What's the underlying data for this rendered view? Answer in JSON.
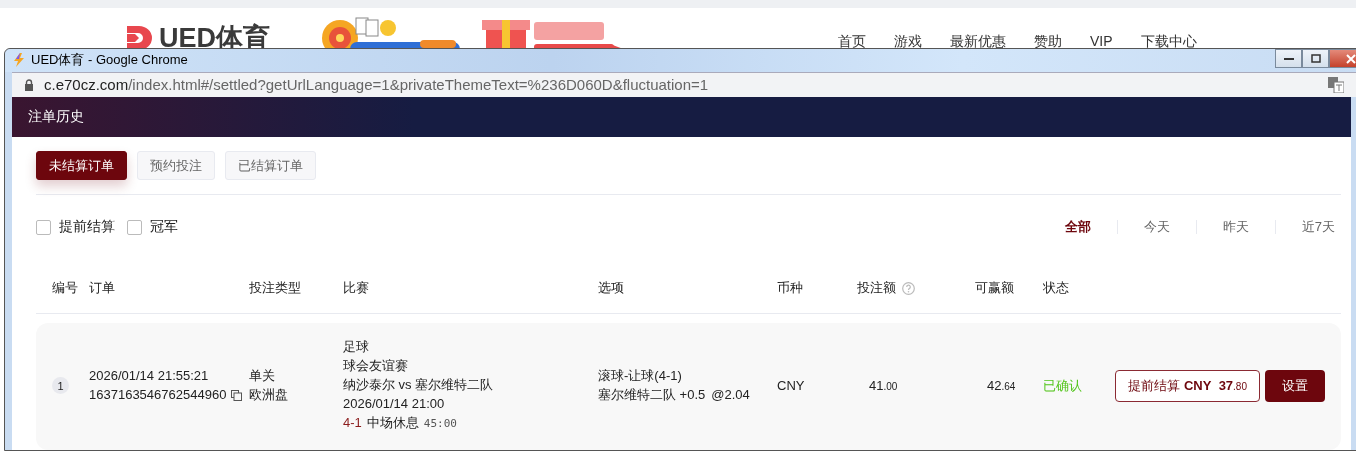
{
  "site": {
    "logo": "UED体育",
    "nav": [
      "首页",
      "游戏",
      "最新优惠",
      "赞助",
      "VIP",
      "下载中心"
    ]
  },
  "window": {
    "title": "UED体育 - Google Chrome",
    "url_host": "c.e70cz.com",
    "url_path": "/index.html#/settled?getUrlLanguage=1&privateThemeText=%236D060D&fluctuation=1"
  },
  "page": {
    "title": "注单历史"
  },
  "tabs": [
    {
      "label": "未结算订单",
      "selected": true
    },
    {
      "label": "预约投注",
      "selected": false
    },
    {
      "label": "已结算订单",
      "selected": false
    }
  ],
  "filters": [
    {
      "label": "提前结算",
      "checked": false
    },
    {
      "label": "冠军",
      "checked": false
    }
  ],
  "date_ranges": [
    {
      "label": "全部",
      "selected": true
    },
    {
      "label": "今天",
      "selected": false
    },
    {
      "label": "昨天",
      "selected": false
    },
    {
      "label": "近7天",
      "selected": false
    }
  ],
  "columns": [
    {
      "label": "编号",
      "help": false
    },
    {
      "label": "订单",
      "help": false
    },
    {
      "label": "投注类型",
      "help": false
    },
    {
      "label": "比赛",
      "help": false
    },
    {
      "label": "选项",
      "help": false
    },
    {
      "label": "币种",
      "help": false
    },
    {
      "label": "投注额",
      "help": true
    },
    {
      "label": "可赢额",
      "help": false
    },
    {
      "label": "状态",
      "help": false
    }
  ],
  "rows": [
    {
      "index": "1",
      "time": "2026/01/14 21:55:21",
      "order_no": "1637163546762544960",
      "bet_type": [
        "单关",
        "欧洲盘"
      ],
      "sport": "足球",
      "league": "球会友谊赛",
      "match": "纳沙泰尔 vs 塞尔维特二队",
      "kickoff": "2026/01/14 21:00",
      "score": "4-1",
      "period": "中场休息",
      "clock": "45:00",
      "market": "滚球-让球(4-1)",
      "selection": "塞尔维特二队 +0.5",
      "odds": "@2.04",
      "currency": "CNY",
      "stake": {
        "int": "41",
        "dec": ".00"
      },
      "win": {
        "int": "42",
        "dec": ".64"
      },
      "status": "已确认",
      "color": "#52c41a",
      "cashout": {
        "label": "提前结算",
        "currency": "CNY",
        "int": "37",
        "dec": ".80"
      },
      "settings": "设置"
    }
  ]
}
